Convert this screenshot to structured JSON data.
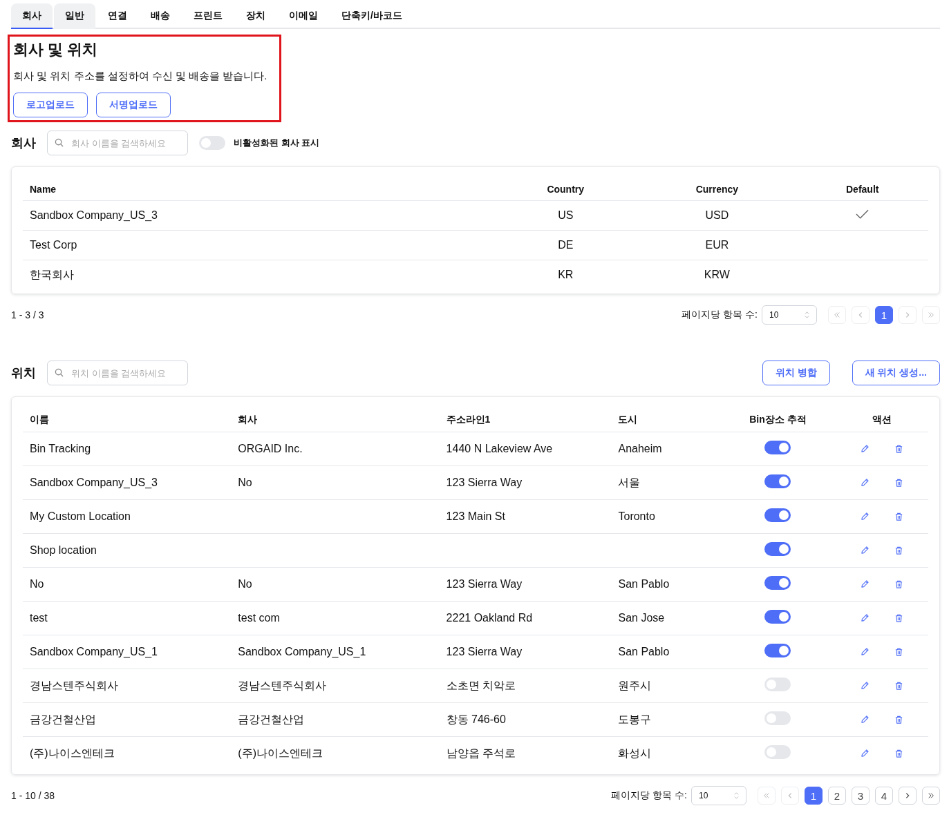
{
  "tabs": [
    {
      "label": "회사",
      "selected": true,
      "hovered": false
    },
    {
      "label": "일반",
      "selected": false,
      "hovered": true
    },
    {
      "label": "연결",
      "selected": false,
      "hovered": false
    },
    {
      "label": "배송",
      "selected": false,
      "hovered": false
    },
    {
      "label": "프린트",
      "selected": false,
      "hovered": false
    },
    {
      "label": "장치",
      "selected": false,
      "hovered": false
    },
    {
      "label": "이메일",
      "selected": false,
      "hovered": false
    },
    {
      "label": "단축키/바코드",
      "selected": false,
      "hovered": false
    }
  ],
  "header": {
    "title": "회사 및 위치",
    "description": "회사 및 위치 주소를 설정하여 수신 및 배송을 받습니다.",
    "buttons": [
      "로고업로드",
      "서명업로드"
    ],
    "highlighted": true
  },
  "companies": {
    "title": "회사",
    "search": {
      "placeholder": "회사 이름을 검색하세요"
    },
    "show_inactive": {
      "label": "비활성화된 회사 표시",
      "on": false
    },
    "columns": [
      "Name",
      "Country",
      "Currency",
      "Default"
    ],
    "rows": [
      {
        "name": "Sandbox Company_US_3",
        "country": "US",
        "currency": "USD",
        "default": true
      },
      {
        "name": "Test Corp",
        "country": "DE",
        "currency": "EUR",
        "default": false
      },
      {
        "name": "한국회사",
        "country": "KR",
        "currency": "KRW",
        "default": false
      }
    ],
    "range": "1 - 3 / 3",
    "per_page_label": "페이지당 항목 수:",
    "per_page": "10",
    "pages": [
      {
        "label": "1",
        "selected": true
      }
    ],
    "nav": [
      {
        "kind": "first",
        "disabled": true
      },
      {
        "kind": "prev",
        "disabled": true
      },
      {
        "kind": "next",
        "disabled": true
      },
      {
        "kind": "last",
        "disabled": true
      }
    ]
  },
  "locations": {
    "title": "위치",
    "search": {
      "placeholder": "위치 이름을 검색하세요"
    },
    "buttons": [
      "위치 병합",
      "새 위치 생성..."
    ],
    "columns": [
      "이름",
      "회사",
      "주소라인1",
      "도시",
      "Bin장소 추적",
      "액션"
    ],
    "rows": [
      {
        "name": "Bin Tracking",
        "company": "ORGAID Inc.",
        "address": "1440 N Lakeview Ave",
        "city": "Anaheim",
        "bin_tracking": true
      },
      {
        "name": "Sandbox Company_US_3",
        "company": "No",
        "address": "123 Sierra Way",
        "city": "서울",
        "bin_tracking": true
      },
      {
        "name": "My Custom Location",
        "company": "",
        "address": "123 Main St",
        "city": "Toronto",
        "bin_tracking": true
      },
      {
        "name": "Shop location",
        "company": "",
        "address": "",
        "city": "",
        "bin_tracking": true
      },
      {
        "name": "No",
        "company": "No",
        "address": "123 Sierra Way",
        "city": "San Pablo",
        "bin_tracking": true
      },
      {
        "name": "test",
        "company": "test com",
        "address": "2221 Oakland Rd",
        "city": "San Jose",
        "bin_tracking": true
      },
      {
        "name": "Sandbox Company_US_1",
        "company": "Sandbox Company_US_1",
        "address": "123 Sierra Way",
        "city": "San Pablo",
        "bin_tracking": true
      },
      {
        "name": "경남스텐주식회사",
        "company": "경남스텐주식회사",
        "address": "소초면 치악로",
        "city": "원주시",
        "bin_tracking": false
      },
      {
        "name": "금강건철산업",
        "company": "금강건철산업",
        "address": "창동 746-60",
        "city": "도봉구",
        "bin_tracking": false
      },
      {
        "name": "(주)나이스엔테크",
        "company": "(주)나이스엔테크",
        "address": "남양읍 주석로",
        "city": "화성시",
        "bin_tracking": false
      }
    ],
    "range": "1 - 10 / 38",
    "per_page_label": "페이지당 항목 수:",
    "per_page": "10",
    "pages": [
      {
        "label": "1",
        "selected": true
      },
      {
        "label": "2",
        "selected": false
      },
      {
        "label": "3",
        "selected": false
      },
      {
        "label": "4",
        "selected": false
      }
    ],
    "nav": [
      {
        "kind": "first",
        "disabled": true
      },
      {
        "kind": "prev",
        "disabled": true
      },
      {
        "kind": "next",
        "disabled": false
      },
      {
        "kind": "last",
        "disabled": false
      }
    ]
  }
}
